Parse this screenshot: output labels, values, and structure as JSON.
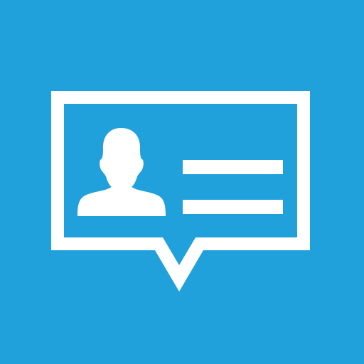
{
  "icon": {
    "name": "contact-message-icon",
    "background_color": "#21A1DC",
    "foreground_color": "#FFFFFF",
    "parts": [
      "speech-bubble-outline",
      "user-silhouette",
      "text-lines"
    ]
  }
}
